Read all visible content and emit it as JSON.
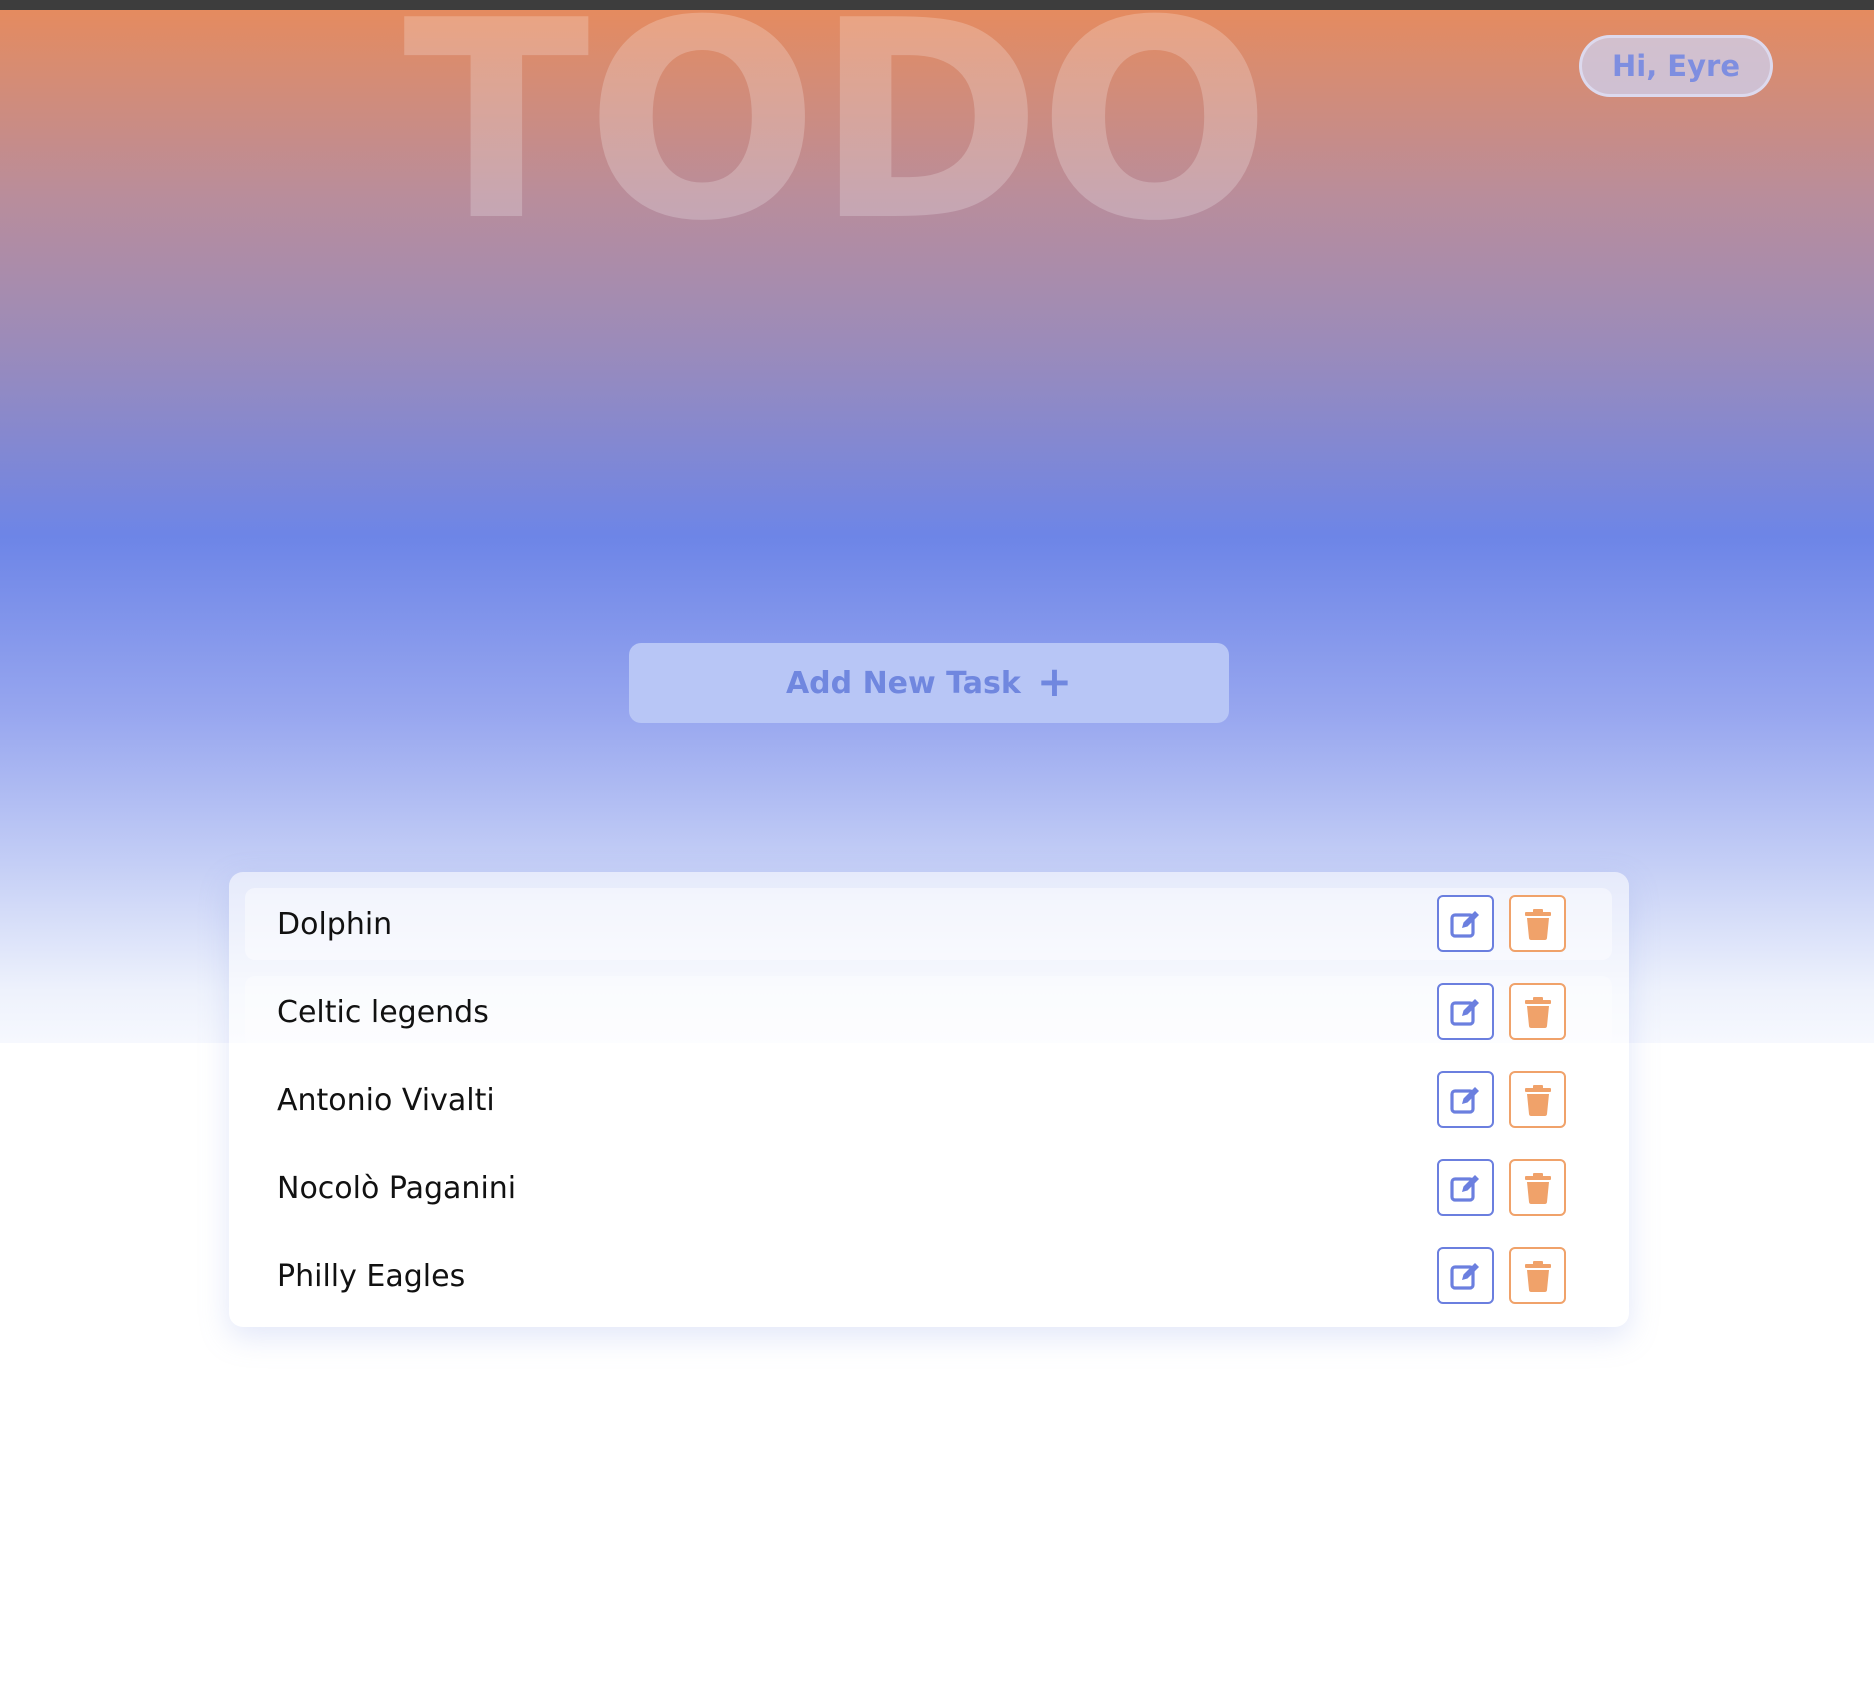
{
  "app": {
    "brand": "TODO",
    "greeting": "Hi, Eyre"
  },
  "actions": {
    "add_task_label": "Add New Task",
    "add_task_icon": "plus-icon"
  },
  "tasks": [
    {
      "title": "Dolphin"
    },
    {
      "title": "Celtic legends"
    },
    {
      "title": "Antonio Vivalti"
    },
    {
      "title": "Nocolò Paganini"
    },
    {
      "title": "Philly Eagles"
    }
  ],
  "row_icons": {
    "edit": "edit-icon",
    "delete": "trash-icon"
  },
  "colors": {
    "gradient_top": "#e58b5f",
    "gradient_mid": "#6d85e7",
    "accent_blue": "#6b7fdf",
    "accent_orange": "#f0a26a",
    "add_button_bg": "#b8c6f6"
  }
}
